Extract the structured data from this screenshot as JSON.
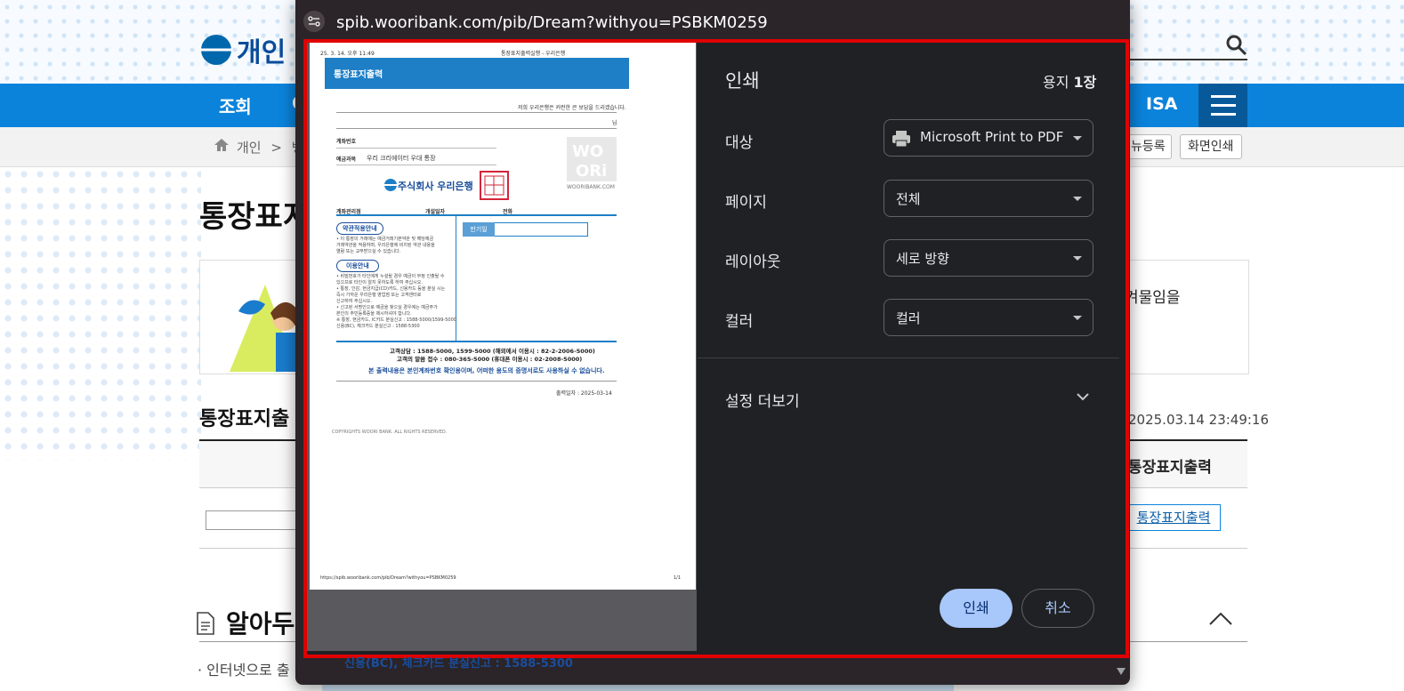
{
  "background_page": {
    "logo_text": "개인",
    "nav": {
      "item_jo": "조회",
      "item_c": "C",
      "item_isa": "ISA"
    },
    "breadcrumb": {
      "home": "개인",
      "sep": ">",
      "next": "뱅"
    },
    "buttons": {
      "menu_register": "뉴등록",
      "screen_print": "화면인쇄"
    },
    "page_title": "통장표지",
    "banner_text": "겨물임을",
    "section_title": "통장표지출",
    "timestamp": "2025.03.14 23:49:16",
    "table_header": "통장표지출력",
    "link_button": "통장표지출력",
    "notice_title": "알아두",
    "bullet_text": "· 인터넷으로 출",
    "bottom_text": "신용(BC), 체크카드 분실신고 : 1588-5300"
  },
  "browser": {
    "url": "spib.wooribank.com/pib/Dream?withyou=PSBKM0259"
  },
  "print_dialog": {
    "title": "인쇄",
    "sheet_count_prefix": "용지",
    "sheet_count_value": "1장",
    "destination_label": "대상",
    "destination_value": "Microsoft Print to PDF",
    "pages_label": "페이지",
    "pages_value": "전체",
    "layout_label": "레이아웃",
    "layout_value": "세로 방향",
    "color_label": "컬러",
    "color_value": "컬러",
    "more_settings": "설정 더보기",
    "print_button": "인쇄",
    "cancel_button": "취소"
  },
  "preview": {
    "header_left": "25. 3. 14. 오후 11:49",
    "header_center": "통장표지출력실행 - 우리은행",
    "banner_title": "통장표지출력",
    "greeting": "저희 우리은행은 커런한 큰 보답을 드리겠습니다.",
    "honorific": "님",
    "account_no_label": "계좌번호",
    "product_label": "예금과목",
    "product_value": "우리 크리에이터 우대 통장",
    "bank_name": "주식회사 우리은행",
    "watermark_brand": "WOORIBANK.COM",
    "branch_label": "계좌관리점",
    "open_date_label": "개설일자",
    "phone_label": "전화",
    "terms_pill": "약관적용안내",
    "terms_text_1": "• 이 통장의 거래에는 예금거래기본약관 및 해당예금",
    "terms_text_2": "거래약관을 적용하며, 우리은행에 비치된 약관 내용을",
    "terms_text_3": "열람 또는 교부받으실 수 있습니다.",
    "usage_pill": "이용안내",
    "usage_text_1": "• 비밀번호가 타인에게 누설될 경우 예금이 부정 인출될 수",
    "usage_text_2": "있으므로 타인이 알지 못하도록 하여 주십시오.",
    "usage_text_3": "• 통장, 인감, 현금지급(CD)카드, 신용카드 등을 분실 시는",
    "usage_text_4": "즉시 가까운 우리은행 영업점 또는 고객센터로",
    "usage_text_5": "신고하여 주십시오.",
    "usage_text_6": "• 신고된 서명인으로 예금을 찾으실 경우에는 예금주가",
    "usage_text_7": "본인의 주민등록증을 제시하셔야 합니다.",
    "usage_text_8": "※ 통장, 현금카드, IC카드 분실신고 : 1588-5000/1599-5000",
    "usage_text_9": "신용(BC), 체크카드 분실신고 : 1588-5300",
    "maturity_label": "만기일",
    "contact_1": "고객상담 : 1588-5000, 1599-5000 (해외에서 이용시 : 82-2-2006-5000)",
    "contact_2": "고객의 말씀 접수 : 080-365-5000 (휴대폰 이용시 : 02-2008-5000)",
    "disclaimer": "본 출력내용은 본인계좌번호 확인용이며, 어떠한 용도의 증명서로도 사용하실 수 없습니다.",
    "print_date": "출력일자 : 2025-03-14",
    "copyright": "COPYRIGHTS WOORI BANK. ALL RIGHTS RESERVED.",
    "footer_url": "https://spib.wooribank.com/pib/Dream?withyou=PSBKM0259",
    "footer_page": "1/1"
  },
  "colors": {
    "bank_blue": "#0b83db",
    "dialog_bg": "#202124",
    "highlight_frame": "#e00000",
    "primary_button": "#a8c7fa"
  }
}
